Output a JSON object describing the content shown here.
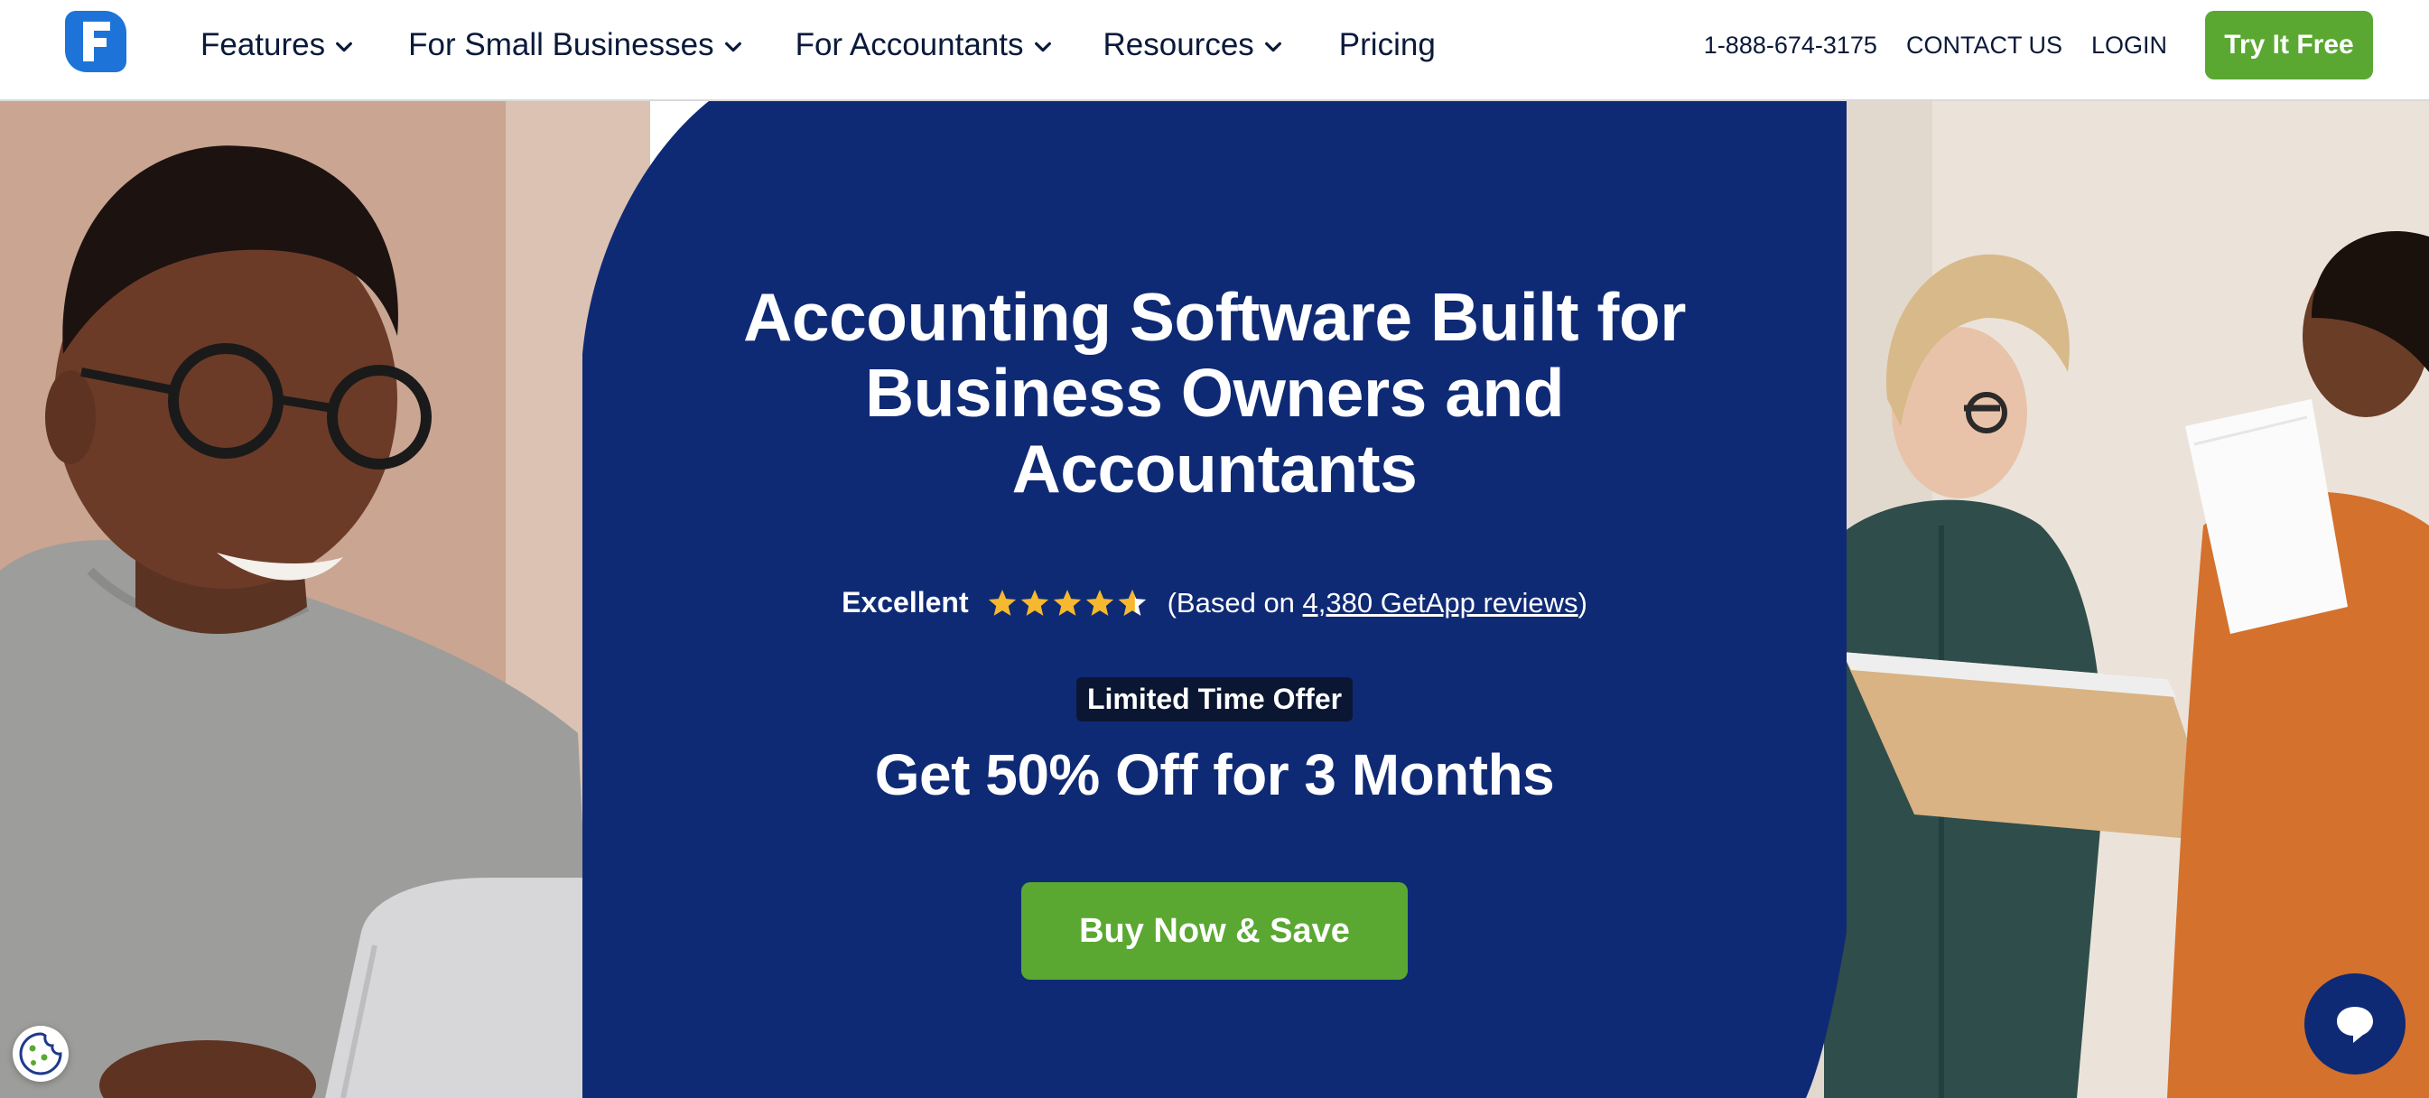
{
  "header": {
    "logo_icon": "freshbooks-f-logo",
    "nav": [
      {
        "label": "Features",
        "has_dropdown": true
      },
      {
        "label": "For Small Businesses",
        "has_dropdown": true
      },
      {
        "label": "For Accountants",
        "has_dropdown": true
      },
      {
        "label": "Resources",
        "has_dropdown": true
      },
      {
        "label": "Pricing",
        "has_dropdown": false
      }
    ],
    "phone": "1-888-674-3175",
    "contact": "CONTACT US",
    "login": "LOGIN",
    "cta": "Try It Free"
  },
  "hero": {
    "headline": "Accounting Software Built for Business Owners and Accountants",
    "rating": {
      "label": "Excellent",
      "stars": 4.5,
      "prefix": "(Based on ",
      "link": "4,380 GetApp reviews",
      "suffix": ")"
    },
    "offer_badge": "Limited Time Offer",
    "offer_headline": "Get 50% Off for 3 Months",
    "cta": "Buy Now & Save"
  },
  "widgets": {
    "cookie_icon": "cookie-icon",
    "chat_icon": "chat-bubble-icon"
  },
  "colors": {
    "brand_blue": "#0f2a75",
    "logo_blue": "#1e73d8",
    "cta_green": "#5aa832",
    "star_yellow": "#f5b82e",
    "text_dark": "#0b1a3a"
  }
}
